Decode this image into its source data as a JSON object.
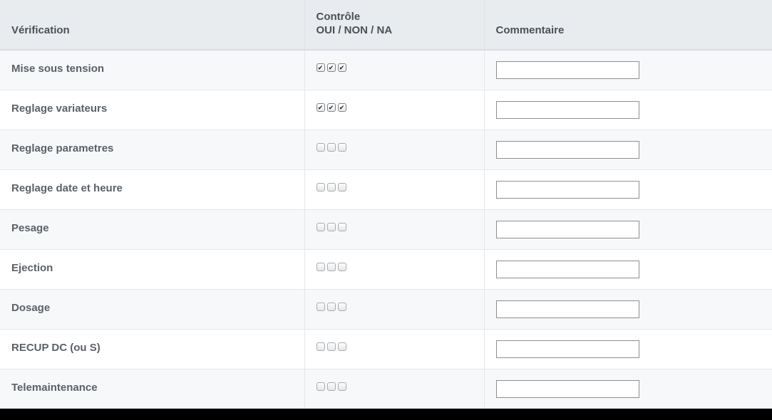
{
  "table": {
    "headers": {
      "verification": "Vérification",
      "controle_line1": "Contrôle",
      "controle_line2": "OUI / NON / NA",
      "commentaire": "Commentaire"
    },
    "rows": [
      {
        "label": "Mise sous tension",
        "checks": [
          true,
          true,
          true
        ],
        "comment": ""
      },
      {
        "label": "Reglage variateurs",
        "checks": [
          true,
          true,
          true
        ],
        "comment": ""
      },
      {
        "label": "Reglage parametres",
        "checks": [
          false,
          false,
          false
        ],
        "comment": ""
      },
      {
        "label": "Reglage date et heure",
        "checks": [
          false,
          false,
          false
        ],
        "comment": ""
      },
      {
        "label": "Pesage",
        "checks": [
          false,
          false,
          false
        ],
        "comment": ""
      },
      {
        "label": "Ejection",
        "checks": [
          false,
          false,
          false
        ],
        "comment": ""
      },
      {
        "label": "Dosage",
        "checks": [
          false,
          false,
          false
        ],
        "comment": ""
      },
      {
        "label": "RECUP DC (ou S)",
        "checks": [
          false,
          false,
          false
        ],
        "comment": ""
      },
      {
        "label": "Telemaintenance",
        "checks": [
          false,
          false,
          false
        ],
        "comment": ""
      }
    ]
  },
  "colors": {
    "header_bg": "#e9ecef",
    "row_alt_bg": "#f7f8fa",
    "text": "#5b6168"
  },
  "icons": {
    "check": "check-icon"
  }
}
